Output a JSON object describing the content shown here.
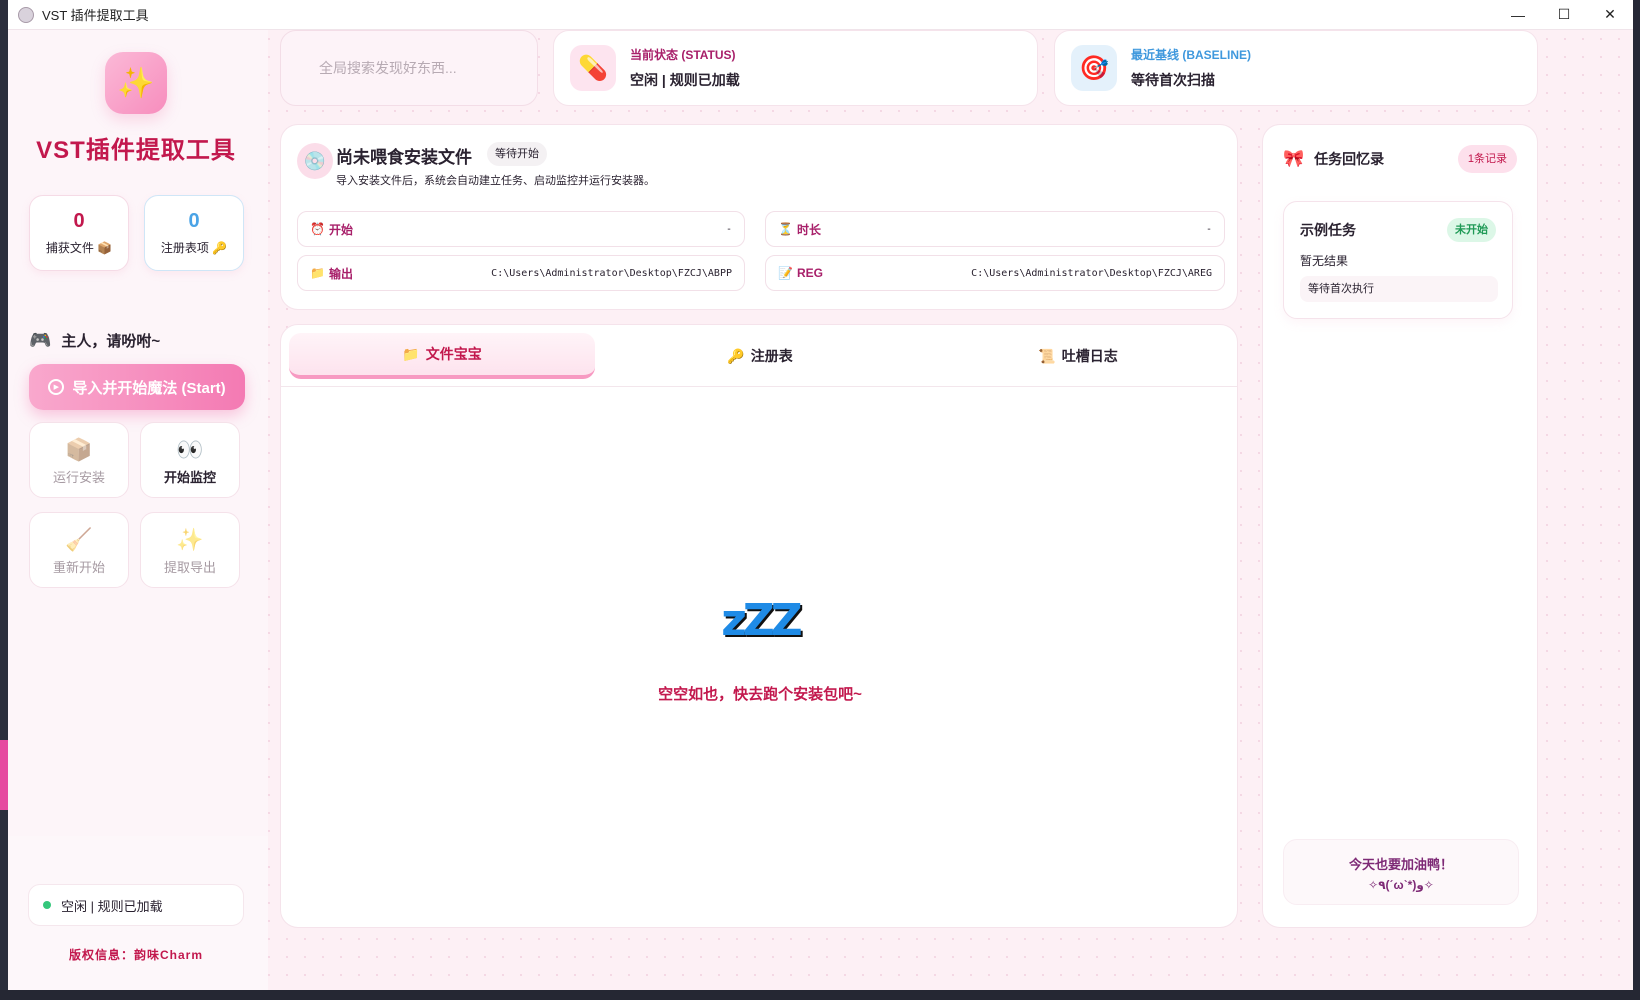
{
  "window": {
    "title": "VST 插件提取工具",
    "controls": {
      "minimize": "—",
      "maximize": "☐",
      "close": "✕"
    }
  },
  "sidebar": {
    "logo_icon": "sparkles-icon",
    "app_name": "VST插件提取工具",
    "stats": [
      {
        "value": "0",
        "label": "捕获文件",
        "icon": "📦"
      },
      {
        "value": "0",
        "label": "注册表项",
        "icon": "🔑"
      }
    ],
    "greeting": "主人，请吩咐~",
    "start_button": "导入并开始魔法 (Start)",
    "actions": [
      {
        "label": "运行安装",
        "icon": "📦",
        "enabled": false
      },
      {
        "label": "开始监控",
        "icon": "👀",
        "enabled": true
      },
      {
        "label": "重新开始",
        "icon": "🧹",
        "enabled": false
      },
      {
        "label": "提取导出",
        "icon": "✨",
        "enabled": false
      }
    ],
    "status_text": "空闲 | 规则已加载",
    "copyright": "版权信息：韵味Charm"
  },
  "topbar": {
    "search_placeholder": "全局搜索发现好东西...",
    "status": {
      "label": "当前状态 (STATUS)",
      "value": "空闲 | 规则已加载",
      "icon": "💊"
    },
    "baseline": {
      "label": "最近基线 (BASELINE)",
      "value": "等待首次扫描",
      "icon": "🎯"
    }
  },
  "task": {
    "title": "尚未喂食安装文件",
    "state_badge": "等待开始",
    "description": "导入安装文件后，系统会自动建立任务、启动监控并运行安装器。",
    "fields": [
      {
        "label": "开始",
        "icon": "⏰",
        "value": "-"
      },
      {
        "label": "时长",
        "icon": "⏳",
        "value": "-"
      },
      {
        "label": "输出",
        "icon": "📁",
        "value": "C:\\Users\\Administrator\\Desktop\\FZCJ\\ABPP"
      },
      {
        "label": "REG",
        "icon": "📝",
        "value": "C:\\Users\\Administrator\\Desktop\\FZCJ\\AREG"
      }
    ]
  },
  "tabs": [
    {
      "label": "文件宝宝",
      "icon": "📁",
      "active": true
    },
    {
      "label": "注册表",
      "icon": "🔑",
      "active": false
    },
    {
      "label": "吐槽日志",
      "icon": "📜",
      "active": false
    }
  ],
  "empty_state": {
    "icon": "zzz-icon",
    "glyph": "zZZ",
    "text": "空空如也，快去跑个安装包吧~"
  },
  "memo": {
    "title": "任务回忆录",
    "count": "1条记录",
    "items": [
      {
        "name": "示例任务",
        "badge": "未开始",
        "result": "暂无结果",
        "detail": "等待首次执行"
      }
    ],
    "cheer_line1": "今天也要加油鸭！",
    "cheer_line2": "✧٩(ˊωˋ*)و✧"
  },
  "colors": {
    "accent": "#c2184d",
    "pink": "#f47ab3",
    "blue": "#3f98dd",
    "green": "#34c77b"
  }
}
